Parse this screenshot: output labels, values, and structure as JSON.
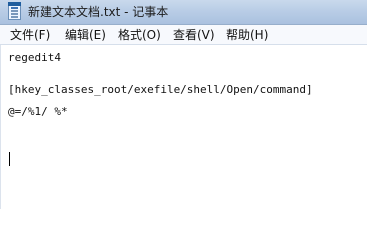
{
  "window": {
    "title": "新建文本文档.txt - 记事本",
    "app_icon": "notepad-icon"
  },
  "menu": {
    "items": [
      {
        "label": "文件(F)"
      },
      {
        "label": "编辑(E)"
      },
      {
        "label": "格式(O)"
      },
      {
        "label": "查看(V)"
      },
      {
        "label": "帮助(H)"
      }
    ]
  },
  "editor": {
    "lines": [
      "regedit4",
      "[hkey_classes_root/exefile/shell/Open/command]",
      "@=/%1/ %*"
    ]
  },
  "colors": {
    "titlebar": "#b9cde6",
    "menubar": "#f7f9fd",
    "editor_bg": "#ffffff"
  }
}
